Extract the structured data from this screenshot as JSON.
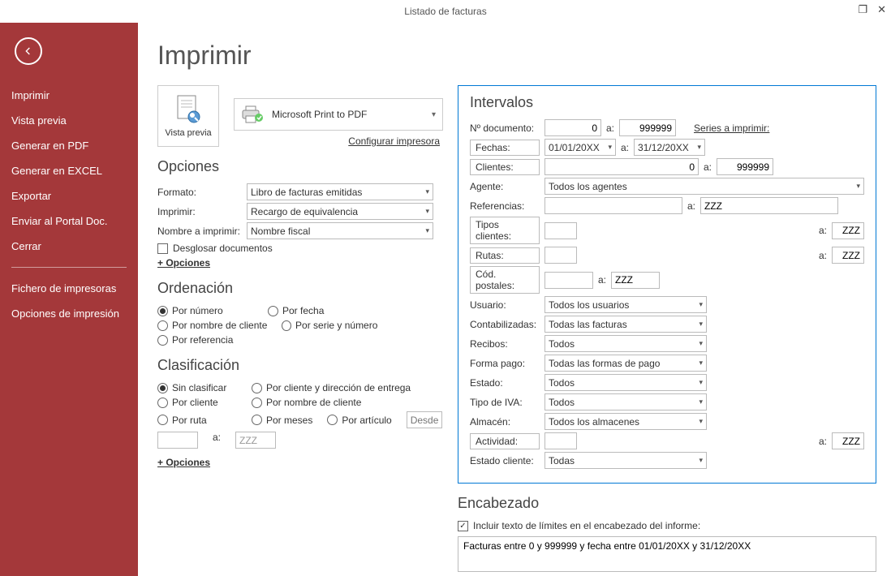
{
  "window": {
    "title": "Listado de facturas"
  },
  "page": {
    "title": "Imprimir"
  },
  "sidebar": {
    "items": [
      "Imprimir",
      "Vista previa",
      "Generar en PDF",
      "Generar en EXCEL",
      "Exportar",
      "Enviar al Portal Doc.",
      "Cerrar"
    ],
    "extra": [
      "Fichero de impresoras",
      "Opciones de impresión"
    ]
  },
  "preview": {
    "label": "Vista previa"
  },
  "printer": {
    "name": "Microsoft Print to PDF"
  },
  "config_link": "Configurar impresora",
  "opciones": {
    "heading": "Opciones",
    "formato_label": "Formato:",
    "formato_value": "Libro de facturas emitidas",
    "imprimir_label": "Imprimir:",
    "imprimir_value": "Recargo de equivalencia",
    "nombre_label": "Nombre a imprimir:",
    "nombre_value": "Nombre fiscal",
    "desglosar": "Desglosar documentos",
    "mas": "+ Opciones"
  },
  "ordenacion": {
    "heading": "Ordenación",
    "opts": [
      "Por número",
      "Por fecha",
      "Por nombre de cliente",
      "Por serie y número",
      "Por referencia"
    ]
  },
  "clasificacion": {
    "heading": "Clasificación",
    "opts": [
      "Sin clasificar",
      "Por cliente y dirección de entrega",
      "Por cliente",
      "Por nombre de cliente",
      "Por ruta",
      "Por meses",
      "Por artículo"
    ],
    "desde": "Desde:",
    "a": "a:",
    "a_val": "ZZZ",
    "mas": "+ Opciones"
  },
  "intervalos": {
    "heading": "Intervalos",
    "ndoc_label": "Nº documento:",
    "ndoc_from": "0",
    "a": "a:",
    "ndoc_to": "999999",
    "series_link": "Series a imprimir:",
    "fechas_label": "Fechas:",
    "fecha_from": "01/01/20XX",
    "fecha_to": "31/12/20XX",
    "clientes_label": "Clientes:",
    "cli_from": "0",
    "cli_to": "999999",
    "agente_label": "Agente:",
    "agente_value": "Todos los agentes",
    "ref_label": "Referencias:",
    "ref_to": "ZZZ",
    "tipos_label": "Tipos clientes:",
    "tipos_to": "ZZZ",
    "rutas_label": "Rutas:",
    "rutas_to": "ZZZ",
    "cp_label": "Cód. postales:",
    "cp_to": "ZZZ",
    "usuario_label": "Usuario:",
    "usuario_value": "Todos los usuarios",
    "contab_label": "Contabilizadas:",
    "contab_value": "Todas las facturas",
    "recibos_label": "Recibos:",
    "recibos_value": "Todos",
    "forma_label": "Forma pago:",
    "forma_value": "Todas las formas de pago",
    "estado_label": "Estado:",
    "estado_value": "Todos",
    "iva_label": "Tipo de IVA:",
    "iva_value": "Todos",
    "almacen_label": "Almacén:",
    "almacen_value": "Todos los almacenes",
    "actividad_label": "Actividad:",
    "actividad_to": "ZZZ",
    "ecli_label": "Estado cliente:",
    "ecli_value": "Todas"
  },
  "encabezado": {
    "heading": "Encabezado",
    "incluir": "Incluir texto de límites en el encabezado del informe:",
    "text": "Facturas entre 0 y 999999 y fecha entre 01/01/20XX y 31/12/20XX"
  }
}
